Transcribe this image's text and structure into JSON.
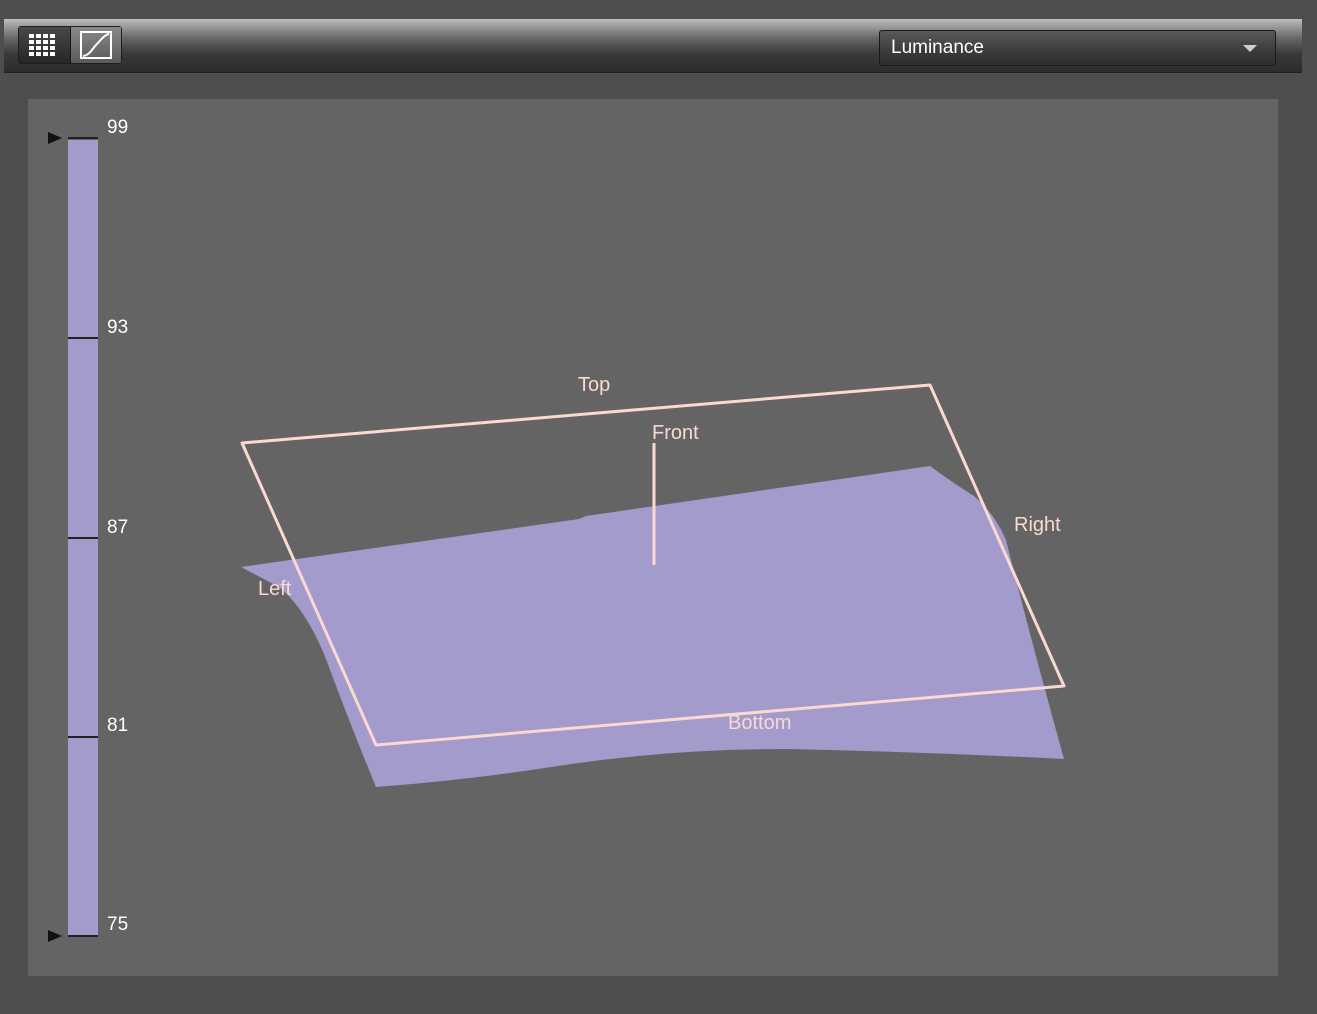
{
  "toolbar": {
    "grid_view_icon": "grid-icon",
    "curve_view_icon": "curve-icon",
    "dropdown": {
      "selected": "Luminance",
      "icon": "chevron-down-icon"
    }
  },
  "scale": {
    "ticks": [
      "99",
      "93",
      "87",
      "81",
      "75"
    ],
    "max_marker_icon": "triangle-right-icon",
    "min_marker_icon": "triangle-right-icon",
    "color": "#a29bcb"
  },
  "plot": {
    "labels": {
      "top": "Top",
      "front": "Front",
      "right": "Right",
      "left": "Left",
      "bottom": "Bottom"
    },
    "frame_color": "#fbd9d0",
    "surface_color": "#a29bcb"
  }
}
